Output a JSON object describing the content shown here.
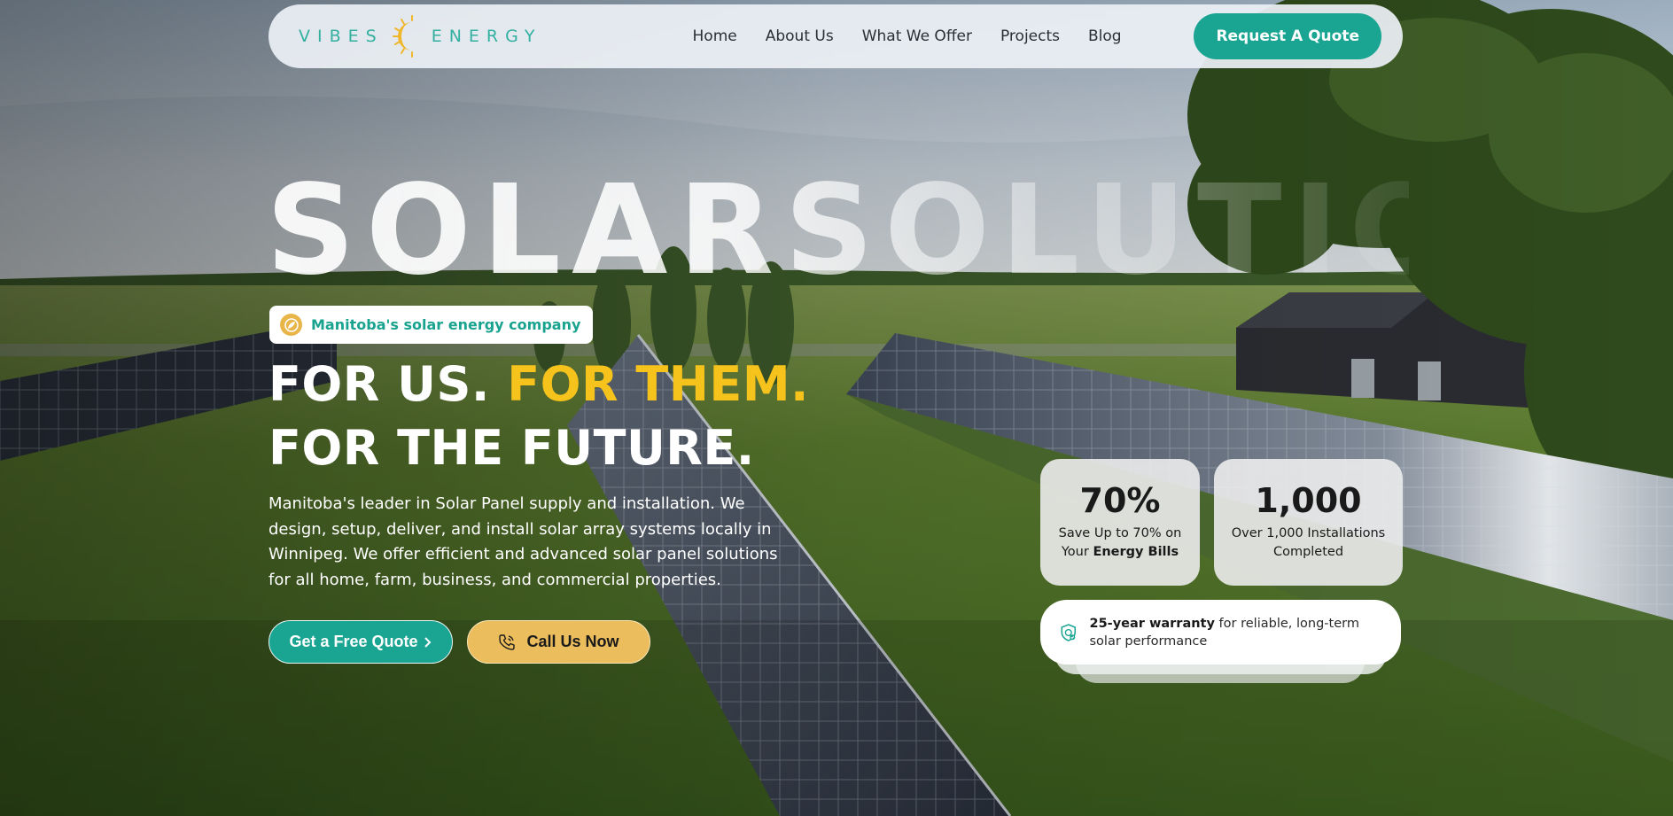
{
  "brand": {
    "word_left": "VIBES",
    "word_right": "ENERGY"
  },
  "nav": {
    "items": [
      {
        "label": "Home"
      },
      {
        "label": "About Us"
      },
      {
        "label": "What We Offer"
      },
      {
        "label": "Projects"
      },
      {
        "label": "Blog"
      }
    ],
    "cta_label": "Request A Quote"
  },
  "hero": {
    "ghost_title": "SOLARSOLUTIONS",
    "badge": "Manitoba's solar energy company",
    "headline_part1": "FOR US. ",
    "headline_accent": "FOR THEM.",
    "headline_line2": "FOR THE FUTURE.",
    "description": "Manitoba's leader in Solar Panel supply and installation. We design, setup, deliver, and install solar array systems locally in Winnipeg. We offer efficient and advanced solar panel solutions for all home, farm, business, and commercial properties.",
    "btn_free": "Get a Free Quote",
    "btn_call": "Call Us Now"
  },
  "stats": [
    {
      "value": "70%",
      "line1": "Save Up to 70% on",
      "line2_prefix": "Your ",
      "line2_bold": "Energy Bills"
    },
    {
      "value": "1,000",
      "line1": "Over 1,000 Installations",
      "line2": "Completed"
    }
  ],
  "warranty": {
    "bold": "25-year warranty",
    "rest": " for reliable, long-term solar performance"
  },
  "colors": {
    "teal": "#1aa593",
    "gold": "#f6c21c",
    "call_button": "#ecbd5c"
  },
  "icons": [
    "sun-logo-icon",
    "leaf-globe-icon",
    "chevron-right-icon",
    "phone-icon",
    "shield-check-icon"
  ]
}
